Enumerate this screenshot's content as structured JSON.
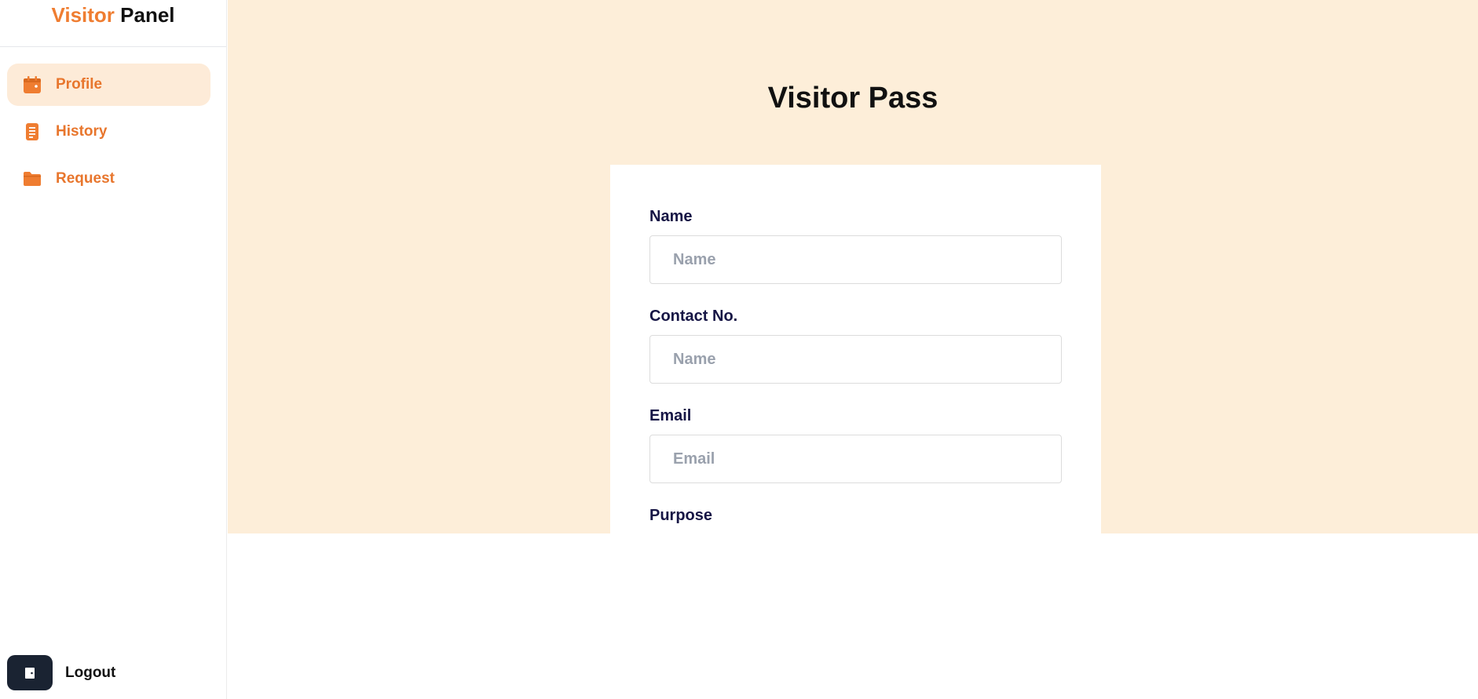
{
  "sidebar": {
    "brand": {
      "accent": "Visitor",
      "rest": "Panel"
    },
    "items": [
      {
        "label": "Profile",
        "icon": "calendar-icon",
        "active": true
      },
      {
        "label": "History",
        "icon": "document-icon",
        "active": false
      },
      {
        "label": "Request",
        "icon": "folder-icon",
        "active": false
      }
    ],
    "logout": {
      "label": "Logout",
      "icon": "door-icon"
    }
  },
  "main": {
    "title": "Visitor Pass",
    "form": {
      "fields": [
        {
          "label": "Name",
          "placeholder": "Name",
          "value": ""
        },
        {
          "label": "Contact No.",
          "placeholder": "Name",
          "value": ""
        },
        {
          "label": "Email",
          "placeholder": "Email",
          "value": ""
        },
        {
          "label": "Purpose"
        }
      ]
    }
  },
  "colors": {
    "accent": "#ef7d31",
    "hero_bg": "#fdeed9",
    "active_item_bg": "#fdebd8",
    "label_navy": "#161545",
    "logout_bg": "#1a2332"
  }
}
